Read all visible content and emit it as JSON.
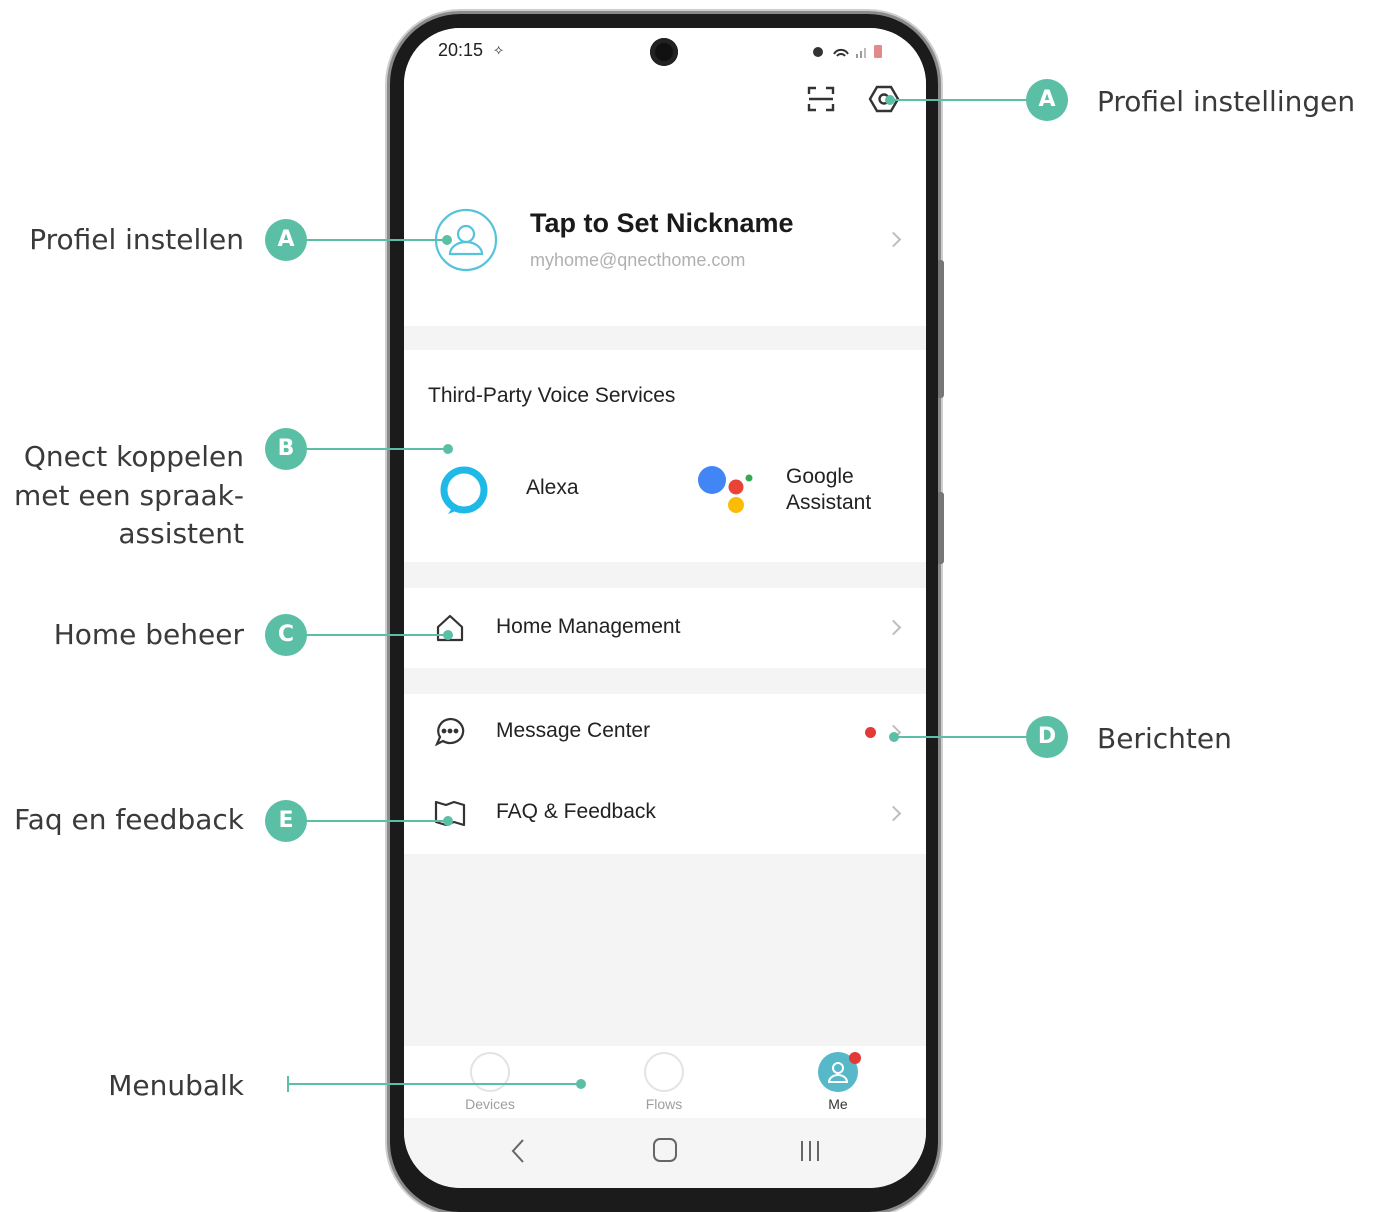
{
  "status_bar": {
    "time": "20:15"
  },
  "profile": {
    "nickname": "Tap to Set Nickname",
    "email": "myhome@qnecthome.com"
  },
  "voice_services": {
    "heading": "Third-Party Voice Services",
    "alexa": "Alexa",
    "google_line1": "Google",
    "google_line2": "Assistant"
  },
  "menu": {
    "home_management": "Home Management",
    "message_center": "Message Center",
    "faq": "FAQ & Feedback"
  },
  "tabbar": {
    "devices": "Devices",
    "flows": "Flows",
    "me": "Me"
  },
  "callouts": {
    "profile_settings": {
      "badge": "A",
      "label": "Profiel instellingen"
    },
    "profile_setup": {
      "badge": "A",
      "label": "Profiel instellen"
    },
    "voice": {
      "badge": "B",
      "line1": "Qnect koppelen",
      "line2": "met een spraak-",
      "line3": "assistent"
    },
    "home": {
      "badge": "C",
      "label": "Home beheer"
    },
    "messages": {
      "badge": "D",
      "label": "Berichten"
    },
    "faq": {
      "badge": "E",
      "label": "Faq en feedback"
    },
    "menubar": {
      "label": "Menubalk"
    }
  },
  "colors": {
    "accent": "#5bbfa5",
    "notification_dot": "#e53935",
    "alexa": "#1fb9e8",
    "google_blue": "#4285f4",
    "google_red": "#ea4335",
    "google_yellow": "#fbbc05",
    "google_green": "#34a853"
  }
}
